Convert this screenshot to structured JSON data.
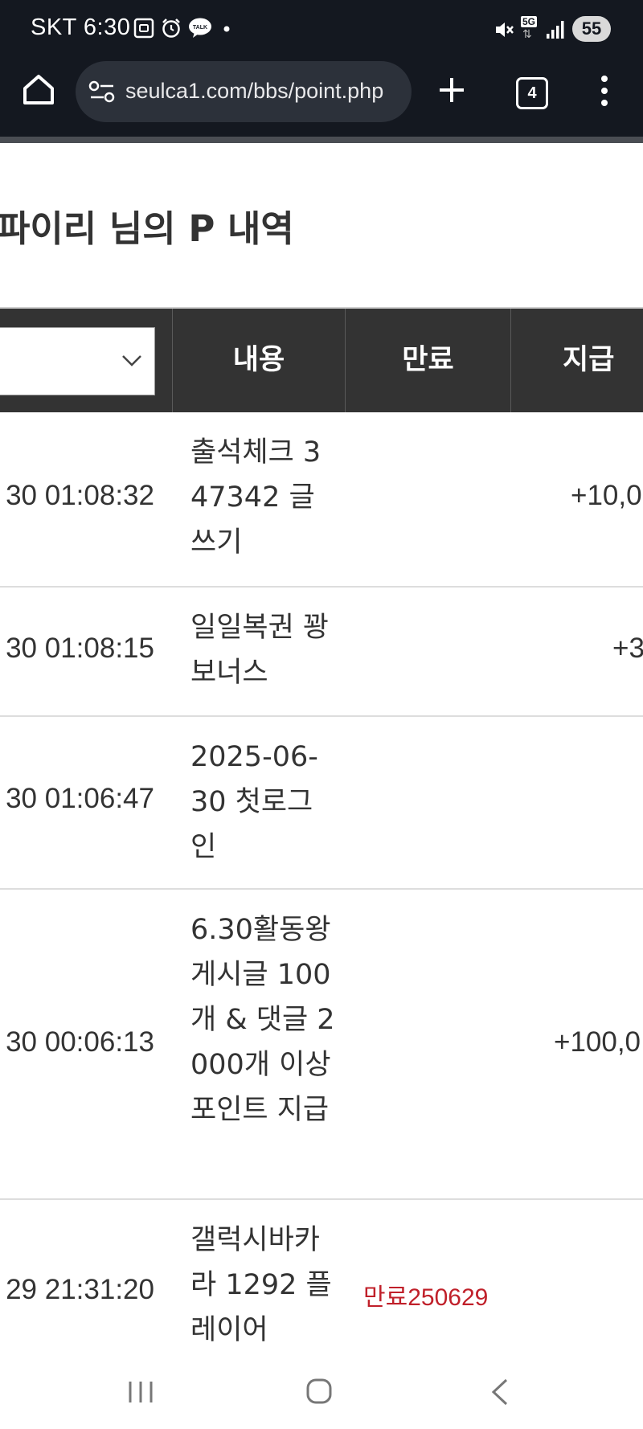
{
  "status_bar": {
    "carrier_time": "SKT 6:30",
    "network": "5G",
    "battery": "55",
    "icons": [
      "screen-record-icon",
      "alarm-icon",
      "kakaotalk-icon",
      "dot-icon",
      "mute-icon",
      "signal-icon"
    ]
  },
  "browser": {
    "url": "seulca1.com/bbs/point.php",
    "tab_count": "4"
  },
  "page": {
    "title": "파이리 님의 P 내역"
  },
  "table": {
    "headers": {
      "content": "내용",
      "expire": "만료",
      "give": "지급"
    },
    "rows": [
      {
        "date": "30 01:08:32",
        "content": "출석체크 347342 글쓰기",
        "expire": "",
        "amount": "+10,0"
      },
      {
        "date": "30 01:08:15",
        "content": "일일복권 꽝 보너스",
        "expire": "",
        "amount": "+3"
      },
      {
        "date": "30 01:06:47",
        "content": "2025-06-30 첫로그인",
        "expire": "",
        "amount": ""
      },
      {
        "date": "30 00:06:13",
        "content": "6.30활동왕 게시글 100개 & 댓글 2000개 이상 포인트 지급",
        "expire": "",
        "amount": "+100,0"
      },
      {
        "date": "29 21:31:20",
        "content": "갤럭시바카라 1292 플레이어",
        "expire": "만료250629",
        "amount": ""
      }
    ]
  }
}
